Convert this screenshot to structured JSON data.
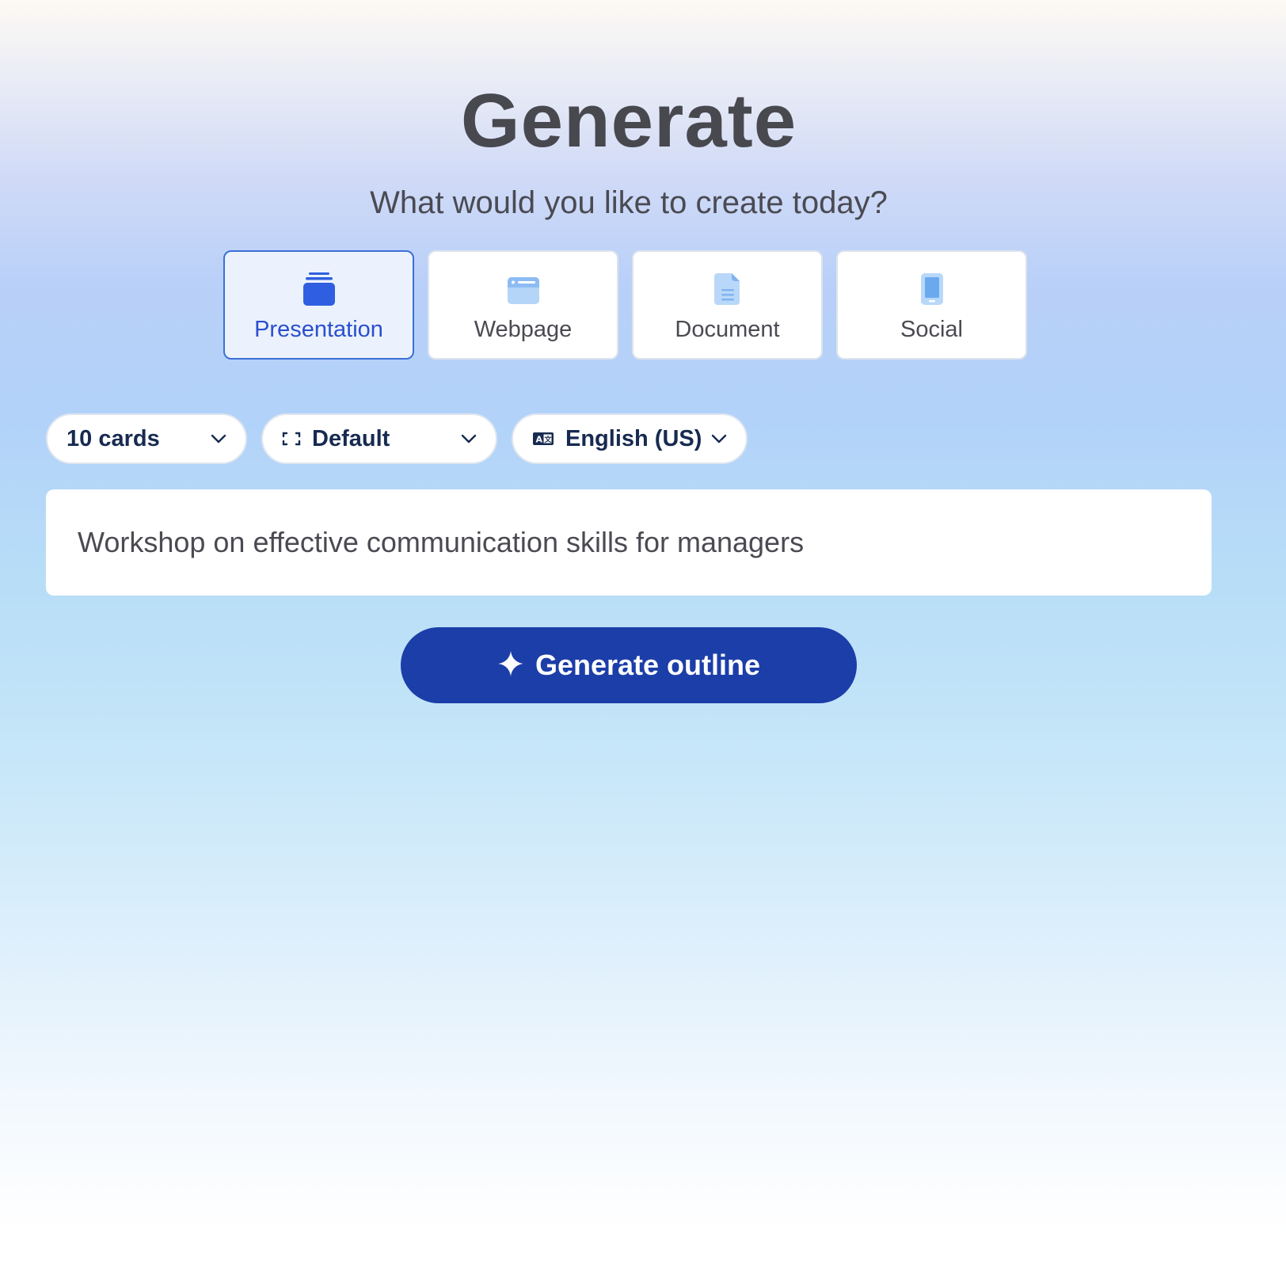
{
  "header": {
    "title": "Generate",
    "subtitle": "What would you like to create today?"
  },
  "types": [
    {
      "label": "Presentation",
      "icon": "presentation-stack-icon",
      "selected": true
    },
    {
      "label": "Webpage",
      "icon": "browser-window-icon",
      "selected": false
    },
    {
      "label": "Document",
      "icon": "document-icon",
      "selected": false
    },
    {
      "label": "Social",
      "icon": "phone-icon",
      "selected": false
    }
  ],
  "options": {
    "cards": {
      "label": "10 cards",
      "icon": "chevron-down-icon"
    },
    "format": {
      "label": "Default",
      "icon": "aspect-ratio-icon"
    },
    "language": {
      "label": "English (US)",
      "icon": "translate-icon"
    }
  },
  "prompt": {
    "value": "Workshop on effective communication skills for managers"
  },
  "actions": {
    "generate_label": "Generate outline",
    "generate_icon": "sparkle-icon"
  },
  "colors": {
    "accent": "#1c3ea8",
    "selected_border": "#3b70d6",
    "selected_text": "#2a4fce",
    "icon_blue": "#2f5fe0",
    "icon_light_blue": "#8cbcf4"
  }
}
